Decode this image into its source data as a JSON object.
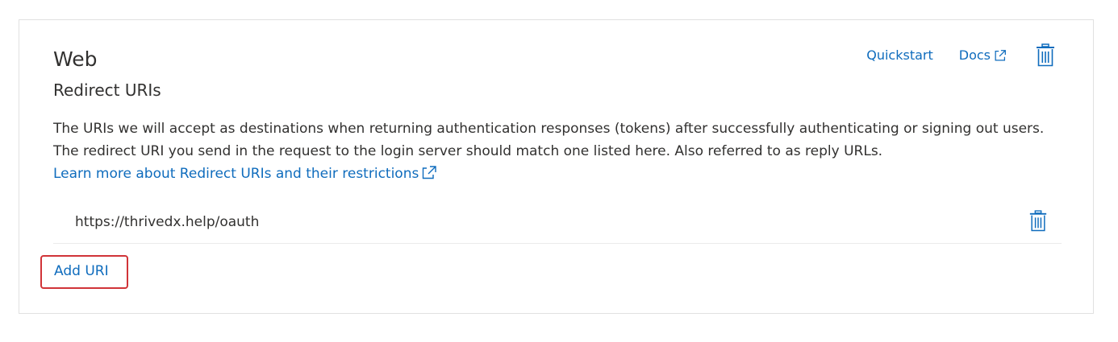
{
  "section": {
    "title": "Web",
    "subtitle": "Redirect URIs"
  },
  "actions": {
    "quickstart_label": "Quickstart",
    "docs_label": "Docs",
    "delete_icon": "trash-icon",
    "external_icon": "external-link-icon"
  },
  "description": {
    "text": "The URIs we will accept as destinations when returning authentication responses (tokens) after successfully authenticating or signing out users. The redirect URI you send in the request to the login server should match one listed here. Also referred to as reply URLs.",
    "learn_more_label": "Learn more about Redirect URIs and their restrictions"
  },
  "redirect_uris": [
    {
      "value": "https://thrivedx.help/oauth"
    }
  ],
  "add_uri": {
    "label": "Add URI"
  },
  "colors": {
    "link": "#0f6cbd",
    "text": "#323130",
    "highlight_border": "#d13438",
    "card_border": "#e1e1e1"
  }
}
